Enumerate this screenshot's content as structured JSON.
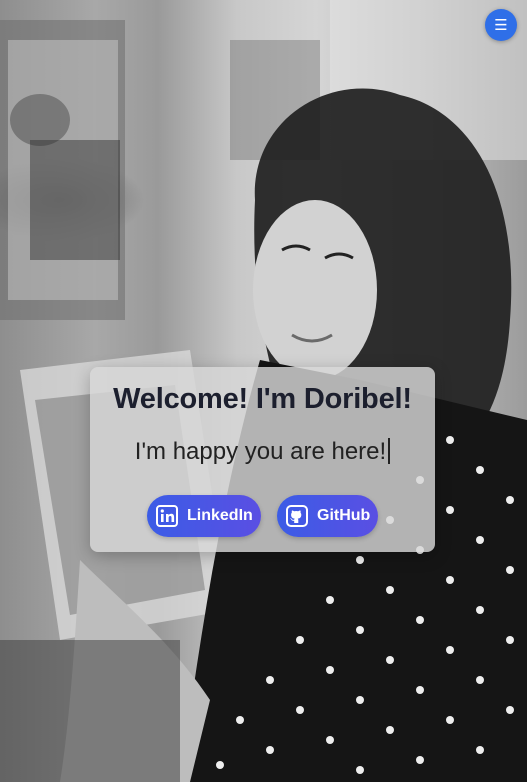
{
  "header": {
    "menu_icon": "hamburger-menu-icon",
    "menu_glyph": "☰",
    "accent_color": "#2f6fe8"
  },
  "hero": {
    "title": "Welcome! I'm Doribel!",
    "subtitle": "I'm happy you are here!"
  },
  "social": [
    {
      "label": "LinkedIn",
      "icon": "linkedin-icon"
    },
    {
      "label": "GitHub",
      "icon": "github-icon"
    }
  ],
  "colors": {
    "button_gradient_start": "#3b5ce6",
    "button_gradient_end": "#5a4fe3",
    "card_background": "#d7d7d7"
  }
}
